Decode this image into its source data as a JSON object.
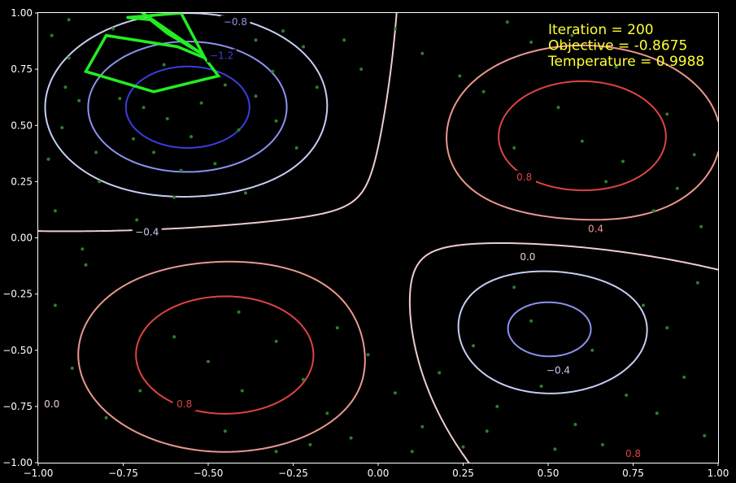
{
  "chart_data": {
    "type": "contour",
    "title": "",
    "xlabel": "",
    "ylabel": "",
    "xlim": [
      -1.0,
      1.0
    ],
    "ylim": [
      -1.0,
      1.0
    ],
    "x_ticks": [
      "−1.00",
      "−0.75",
      "−0.50",
      "−0.25",
      "0.00",
      "0.25",
      "0.50",
      "0.75",
      "1.00"
    ],
    "y_ticks": [
      "1.00",
      "0.75",
      "0.50",
      "0.25",
      "0.00",
      "−0.25",
      "−0.50",
      "−0.75",
      "−1.00"
    ],
    "contour_levels": [
      -1.2,
      -0.8,
      -0.4,
      0.0,
      0.4,
      0.8
    ],
    "contour_labels": [
      {
        "text": "−0.8",
        "x": -0.42,
        "y": 0.96,
        "level": -0.8
      },
      {
        "text": "−1.2",
        "x": -0.46,
        "y": 0.81,
        "level": -1.2
      },
      {
        "text": "−0.4",
        "x": -0.68,
        "y": 0.025,
        "level": -0.4
      },
      {
        "text": "0.8",
        "x": 0.43,
        "y": 0.27,
        "level": 0.8
      },
      {
        "text": "0.4",
        "x": 0.64,
        "y": 0.04,
        "level": 0.4
      },
      {
        "text": "0.0",
        "x": 0.44,
        "y": -0.085,
        "level": 0.0
      },
      {
        "text": "−0.4",
        "x": 0.53,
        "y": -0.59,
        "level": -0.4
      },
      {
        "text": "0.8",
        "x": -0.57,
        "y": -0.74,
        "level": 0.8
      },
      {
        "text": "0.0",
        "x": -0.96,
        "y": -0.74,
        "level": 0.0
      },
      {
        "text": "0.8",
        "x": 0.75,
        "y": -0.96,
        "level": 0.8
      }
    ],
    "level_colors": {
      "-1.2": "#3c3ce0",
      "-0.8": "#8b92ee",
      "-0.4": "#c6cef2",
      "0.0": "#f0cccc",
      "0.4": "#ea9890",
      "0.8": "#dd4444"
    },
    "path_color": "#22ee22",
    "point_color": "#2e7d2e",
    "annotations": [
      {
        "label": "Iteration",
        "value": "200"
      },
      {
        "label": "Objective",
        "value": "-0.8675"
      },
      {
        "label": "Temperature",
        "value": "0.9988"
      }
    ],
    "search_path": [
      [
        -0.74,
        1.05
      ],
      [
        -0.52,
        0.82
      ],
      [
        -0.47,
        0.72
      ],
      [
        -0.66,
        0.65
      ],
      [
        -0.86,
        0.74
      ],
      [
        -0.8,
        0.9
      ],
      [
        -0.59,
        0.85
      ],
      [
        -0.51,
        0.8
      ],
      [
        -0.58,
        1.0
      ],
      [
        -0.74,
        0.98
      ],
      [
        -0.67,
        0.97
      ],
      [
        -0.62,
        0.91
      ],
      [
        -0.52,
        0.82
      ]
    ],
    "sample_points": [
      [
        -0.96,
        0.9
      ],
      [
        -0.91,
        0.8
      ],
      [
        -0.88,
        0.61
      ],
      [
        -0.93,
        0.49
      ],
      [
        -0.97,
        0.35
      ],
      [
        -0.82,
        0.25
      ],
      [
        -0.72,
        0.44
      ],
      [
        -0.69,
        0.58
      ],
      [
        -0.62,
        0.53
      ],
      [
        -0.55,
        0.45
      ],
      [
        -0.48,
        0.33
      ],
      [
        -0.41,
        0.48
      ],
      [
        -0.36,
        0.63
      ],
      [
        -0.31,
        0.74
      ],
      [
        -0.28,
        0.92
      ],
      [
        -0.22,
        0.85
      ],
      [
        -0.44,
        0.95
      ],
      [
        -0.63,
        0.77
      ],
      [
        -0.76,
        0.62
      ],
      [
        -0.58,
        0.3
      ],
      [
        -0.66,
        0.38
      ],
      [
        -0.39,
        0.2
      ],
      [
        -0.3,
        0.52
      ],
      [
        -0.24,
        0.4
      ],
      [
        -0.18,
        0.67
      ],
      [
        -0.1,
        0.88
      ],
      [
        -0.05,
        0.75
      ],
      [
        0.05,
        0.93
      ],
      [
        0.13,
        0.82
      ],
      [
        -0.71,
        0.08
      ],
      [
        -0.87,
        -0.05
      ],
      [
        -0.95,
        0.12
      ],
      [
        -0.78,
        0.93
      ],
      [
        -0.91,
        0.97
      ],
      [
        -0.52,
        0.6
      ],
      [
        -0.45,
        0.68
      ],
      [
        -0.83,
        0.38
      ],
      [
        -0.92,
        0.67
      ],
      [
        -0.36,
        0.88
      ],
      [
        -0.6,
        0.18
      ],
      [
        0.38,
        0.96
      ],
      [
        0.45,
        0.87
      ],
      [
        0.24,
        0.72
      ],
      [
        0.6,
        0.43
      ],
      [
        0.72,
        0.34
      ],
      [
        0.85,
        0.55
      ],
      [
        0.93,
        0.37
      ],
      [
        0.67,
        0.25
      ],
      [
        0.88,
        0.22
      ],
      [
        0.81,
        0.12
      ],
      [
        0.95,
        0.05
      ],
      [
        0.57,
        0.9
      ],
      [
        0.7,
        0.76
      ],
      [
        0.53,
        0.58
      ],
      [
        0.4,
        0.4
      ],
      [
        0.31,
        0.65
      ],
      [
        -0.41,
        -0.33
      ],
      [
        -0.3,
        -0.46
      ],
      [
        -0.5,
        -0.55
      ],
      [
        -0.4,
        -0.68
      ],
      [
        -0.22,
        -0.63
      ],
      [
        -0.15,
        -0.78
      ],
      [
        -0.08,
        -0.89
      ],
      [
        -0.03,
        -0.52
      ],
      [
        0.05,
        -0.69
      ],
      [
        0.13,
        -0.84
      ],
      [
        0.25,
        -0.93
      ],
      [
        0.35,
        -0.75
      ],
      [
        0.48,
        -0.66
      ],
      [
        0.58,
        -0.83
      ],
      [
        0.66,
        -0.92
      ],
      [
        0.73,
        -0.7
      ],
      [
        0.82,
        -0.78
      ],
      [
        0.9,
        -0.62
      ],
      [
        0.96,
        -0.88
      ],
      [
        0.4,
        -0.22
      ],
      [
        0.28,
        -0.48
      ],
      [
        0.18,
        -0.6
      ],
      [
        -0.6,
        -0.44
      ],
      [
        -0.7,
        -0.68
      ],
      [
        -0.8,
        -0.8
      ],
      [
        -0.9,
        -0.58
      ],
      [
        -0.95,
        -0.3
      ],
      [
        -0.86,
        -0.12
      ],
      [
        -0.3,
        -0.95
      ],
      [
        -0.45,
        -0.86
      ],
      [
        0.63,
        -0.5
      ],
      [
        0.45,
        -0.37
      ],
      [
        0.85,
        -0.4
      ],
      [
        0.94,
        -0.2
      ],
      [
        0.78,
        -0.3
      ],
      [
        0.1,
        -0.95
      ],
      [
        0.32,
        -0.86
      ],
      [
        0.52,
        -0.94
      ],
      [
        -0.12,
        -0.4
      ],
      [
        -0.2,
        -0.92
      ]
    ]
  }
}
